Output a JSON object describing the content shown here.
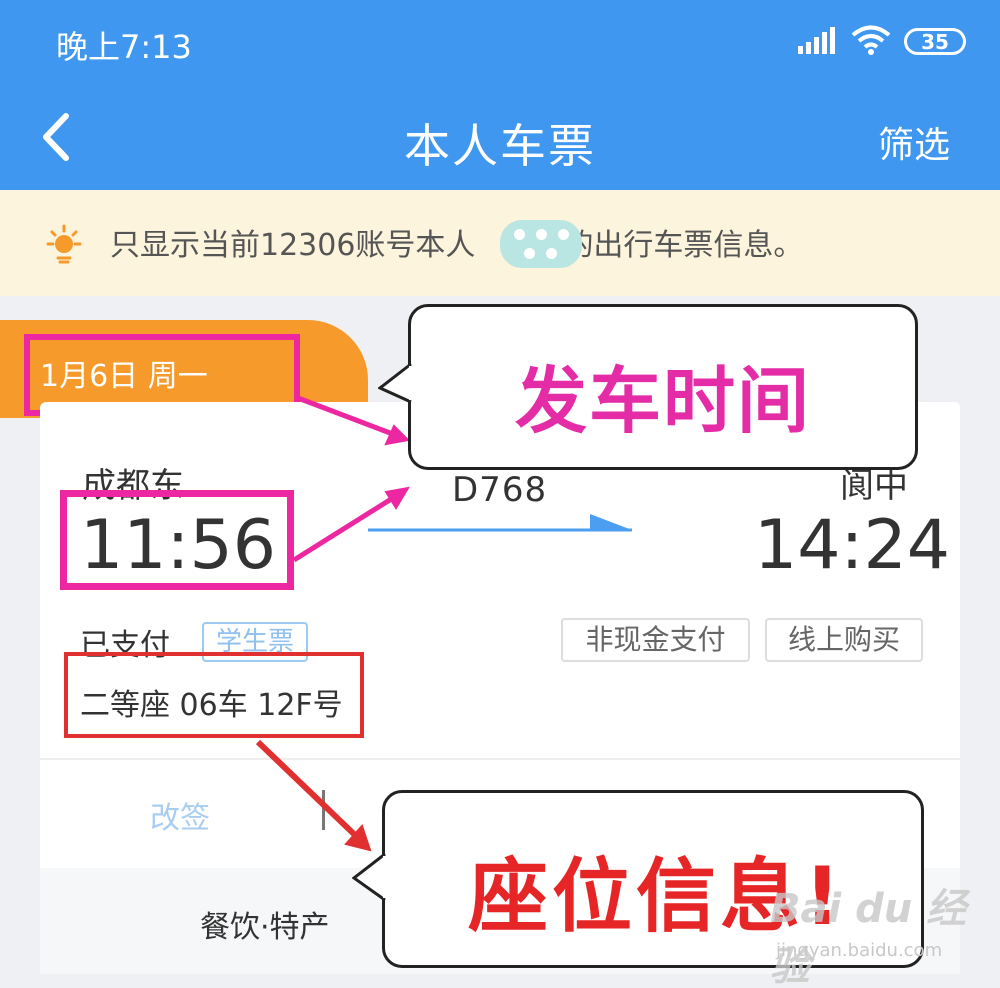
{
  "status": {
    "time": "晚上7:13",
    "battery": "35"
  },
  "nav": {
    "title": "本人车票",
    "filter": "筛选"
  },
  "notice": {
    "text_before": "只显示当前12306账号本人",
    "text_after": "的出行车票信息。"
  },
  "ticket": {
    "date": "1月6日 周一",
    "from_station": "成都东",
    "to_station": "阆中",
    "depart_time": "11:56",
    "arrive_time": "14:24",
    "train_no": "D768",
    "status": "已支付",
    "ticket_type": "学生票",
    "tags": [
      "非现金支付",
      "线上购买"
    ],
    "seat": "二等座 06车 12F号",
    "change_label": "改签",
    "food_label": "餐饮·特产"
  },
  "annotations": {
    "top_callout": "发车时间",
    "bottom_callout": "座位信息!"
  },
  "watermark": {
    "brand": "Bai du 经验",
    "url": "jingyan.baidu.com"
  },
  "colors": {
    "header_blue": "#3f97f0",
    "date_orange": "#f59a2b",
    "highlight_pink": "#ec27a1",
    "highlight_red": "#e03030"
  }
}
